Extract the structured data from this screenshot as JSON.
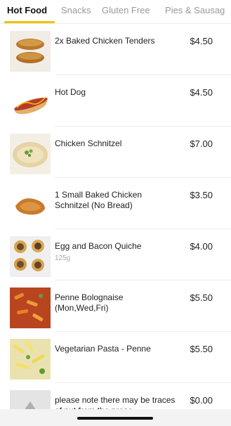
{
  "tabs": [
    {
      "label": "Hot Food",
      "active": true
    },
    {
      "label": "Snacks",
      "active": false
    },
    {
      "label": "Gluten Free",
      "active": false
    },
    {
      "label": "Pies & Sausag",
      "active": false
    }
  ],
  "accent_color": "#f2c200",
  "items": [
    {
      "name": "2x Baked Chicken Tenders",
      "price": "$4.50",
      "sub": "",
      "image": "chicken-tenders-image"
    },
    {
      "name": "Hot Dog",
      "price": "$4.50",
      "sub": "",
      "image": "hot-dog-image"
    },
    {
      "name": "Chicken Schnitzel",
      "price": "$7.00",
      "sub": "",
      "image": "chicken-schnitzel-image"
    },
    {
      "name": "1 Small Baked Chicken Schnitzel (No Bread)",
      "price": "$3.50",
      "sub": "",
      "image": "small-schnitzel-image"
    },
    {
      "name": "Egg and Bacon Quiche",
      "price": "$4.00",
      "sub": "125g",
      "image": "quiche-image"
    },
    {
      "name": "Penne Bolognaise (Mon,Wed,Fri)",
      "price": "$5.50",
      "sub": "",
      "image": "penne-bolognaise-image"
    },
    {
      "name": "Vegetarian Pasta - Penne",
      "price": "$5.50",
      "sub": "",
      "image": "vegetarian-pasta-image"
    },
    {
      "name": "please note there may be traces of nut from the prese",
      "price": "$0.00",
      "sub": "",
      "image": "placeholder-image"
    }
  ]
}
